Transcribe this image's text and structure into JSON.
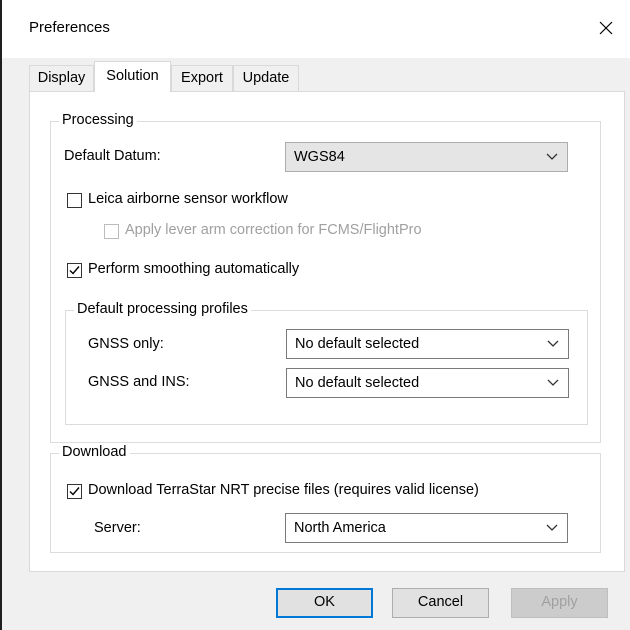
{
  "window": {
    "title": "Preferences"
  },
  "tabs": [
    {
      "label": "Display"
    },
    {
      "label": "Solution"
    },
    {
      "label": "Export"
    },
    {
      "label": "Update"
    }
  ],
  "processing": {
    "legend": "Processing",
    "default_datum_label": "Default Datum:",
    "default_datum_value": "WGS84",
    "leica_label": "Leica airborne sensor workflow",
    "leica_checked": false,
    "lever_arm_label": "Apply lever arm correction for FCMS/FlightPro",
    "lever_arm_checked": false,
    "smoothing_label": "Perform smoothing automatically",
    "smoothing_checked": true,
    "profiles": {
      "legend": "Default processing profiles",
      "gnss_only_label": "GNSS only:",
      "gnss_only_value": "No default selected",
      "gnss_ins_label": "GNSS and INS:",
      "gnss_ins_value": "No default selected"
    }
  },
  "download": {
    "legend": "Download",
    "terrastar_label": "Download TerraStar NRT precise files (requires valid license)",
    "terrastar_checked": true,
    "server_label": "Server:",
    "server_value": "North America"
  },
  "buttons": {
    "ok": "OK",
    "cancel": "Cancel",
    "apply": "Apply"
  }
}
